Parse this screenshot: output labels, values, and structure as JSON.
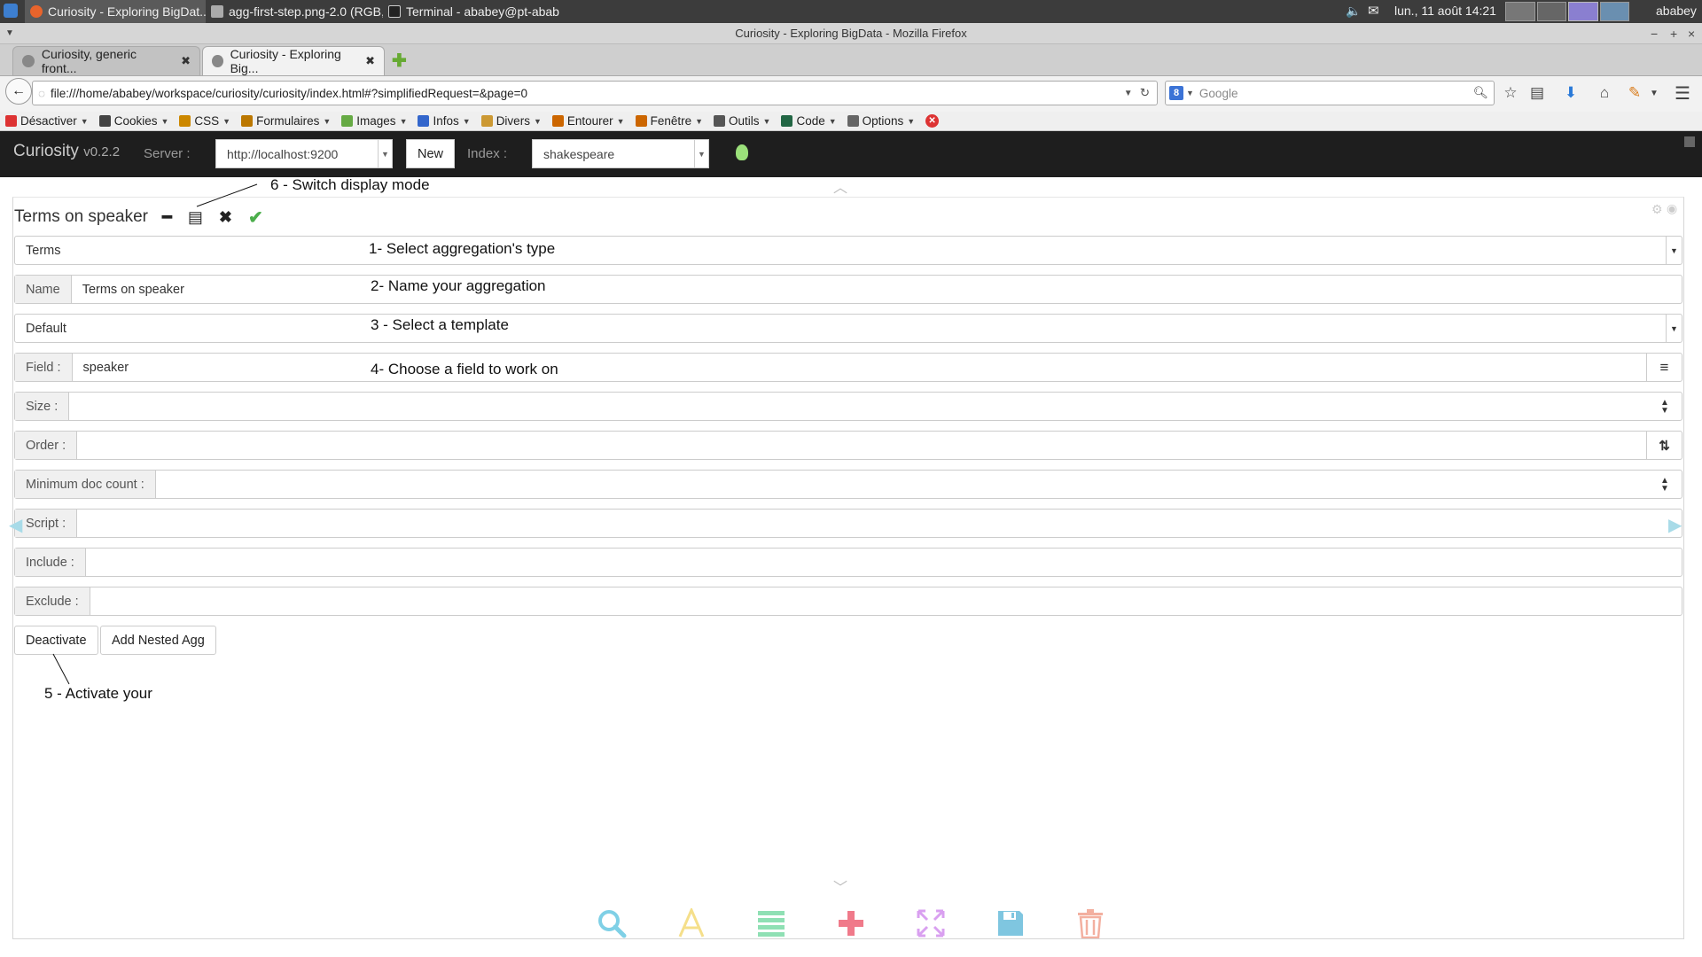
{
  "os": {
    "tasks": [
      {
        "label": "Curiosity - Exploring BigDat..."
      },
      {
        "label": "agg-first-step.png-2.0 (RGB, ..."
      },
      {
        "label": "Terminal - ababey@pt-abab..."
      }
    ],
    "datetime": "lun., 11 août  14:21",
    "user": "ababey"
  },
  "firefox": {
    "window_title": "Curiosity - Exploring BigData - Mozilla Firefox",
    "tabs": [
      {
        "label": "Curiosity, generic front..."
      },
      {
        "label": "Curiosity - Exploring Big..."
      }
    ],
    "url": "file:///home/ababey/workspace/curiosity/curiosity/index.html#?simplifiedRequest=&page=0",
    "search_placeholder": "Google",
    "devtools": [
      {
        "label": "Désactiver",
        "icon": "disable-icon",
        "color": "#d33"
      },
      {
        "label": "Cookies",
        "icon": "cookie-icon",
        "color": "#444"
      },
      {
        "label": "CSS",
        "icon": "css-icon",
        "color": "#c80"
      },
      {
        "label": "Formulaires",
        "icon": "forms-icon",
        "color": "#b70"
      },
      {
        "label": "Images",
        "icon": "images-icon",
        "color": "#6a4"
      },
      {
        "label": "Infos",
        "icon": "info-icon",
        "color": "#36c"
      },
      {
        "label": "Divers",
        "icon": "misc-icon",
        "color": "#c93"
      },
      {
        "label": "Entourer",
        "icon": "outline-icon",
        "color": "#c60"
      },
      {
        "label": "Fenêtre",
        "icon": "window-icon",
        "color": "#c60"
      },
      {
        "label": "Outils",
        "icon": "tools-icon",
        "color": "#555"
      },
      {
        "label": "Code",
        "icon": "code-icon",
        "color": "#264"
      },
      {
        "label": "Options",
        "icon": "options-icon",
        "color": "#666"
      }
    ]
  },
  "app": {
    "name": "Curiosity",
    "version": "v0.2.2",
    "server_label": "Server :",
    "server_value": "http://localhost:9200",
    "new_label": "New",
    "index_label": "Index :",
    "index_value": "shakespeare"
  },
  "agg": {
    "title": "Terms on speaker",
    "type_value": "Terms",
    "name_label": "Name",
    "name_value": "Terms on speaker",
    "template_value": "Default",
    "field_label": "Field :",
    "field_value": "speaker",
    "size_label": "Size :",
    "order_label": "Order :",
    "min_doc_label": "Minimum doc count :",
    "script_label": "Script :",
    "include_label": "Include :",
    "exclude_label": "Exclude :",
    "deactivate_label": "Deactivate",
    "add_nested_label": "Add Nested Agg"
  },
  "annotations": {
    "a1": "1- Select aggregation's type",
    "a2": "2- Name your aggregation",
    "a3": "3 - Select a template",
    "a4": "4- Choose a field to work on",
    "a5": "5 - Activate your",
    "a6": "6 - Switch display mode"
  },
  "bottom_icons": [
    {
      "icon": "search-icon",
      "color": "#7fd0e6"
    },
    {
      "icon": "text-icon",
      "color": "#f5df8a"
    },
    {
      "icon": "list-icon",
      "color": "#8fe0b4"
    },
    {
      "icon": "plus-icon",
      "color": "#f07a8a"
    },
    {
      "icon": "expand-icon",
      "color": "#d9a0f0"
    },
    {
      "icon": "save-icon",
      "color": "#7fc6e0"
    },
    {
      "icon": "trash-icon",
      "color": "#f3b0a0"
    }
  ]
}
